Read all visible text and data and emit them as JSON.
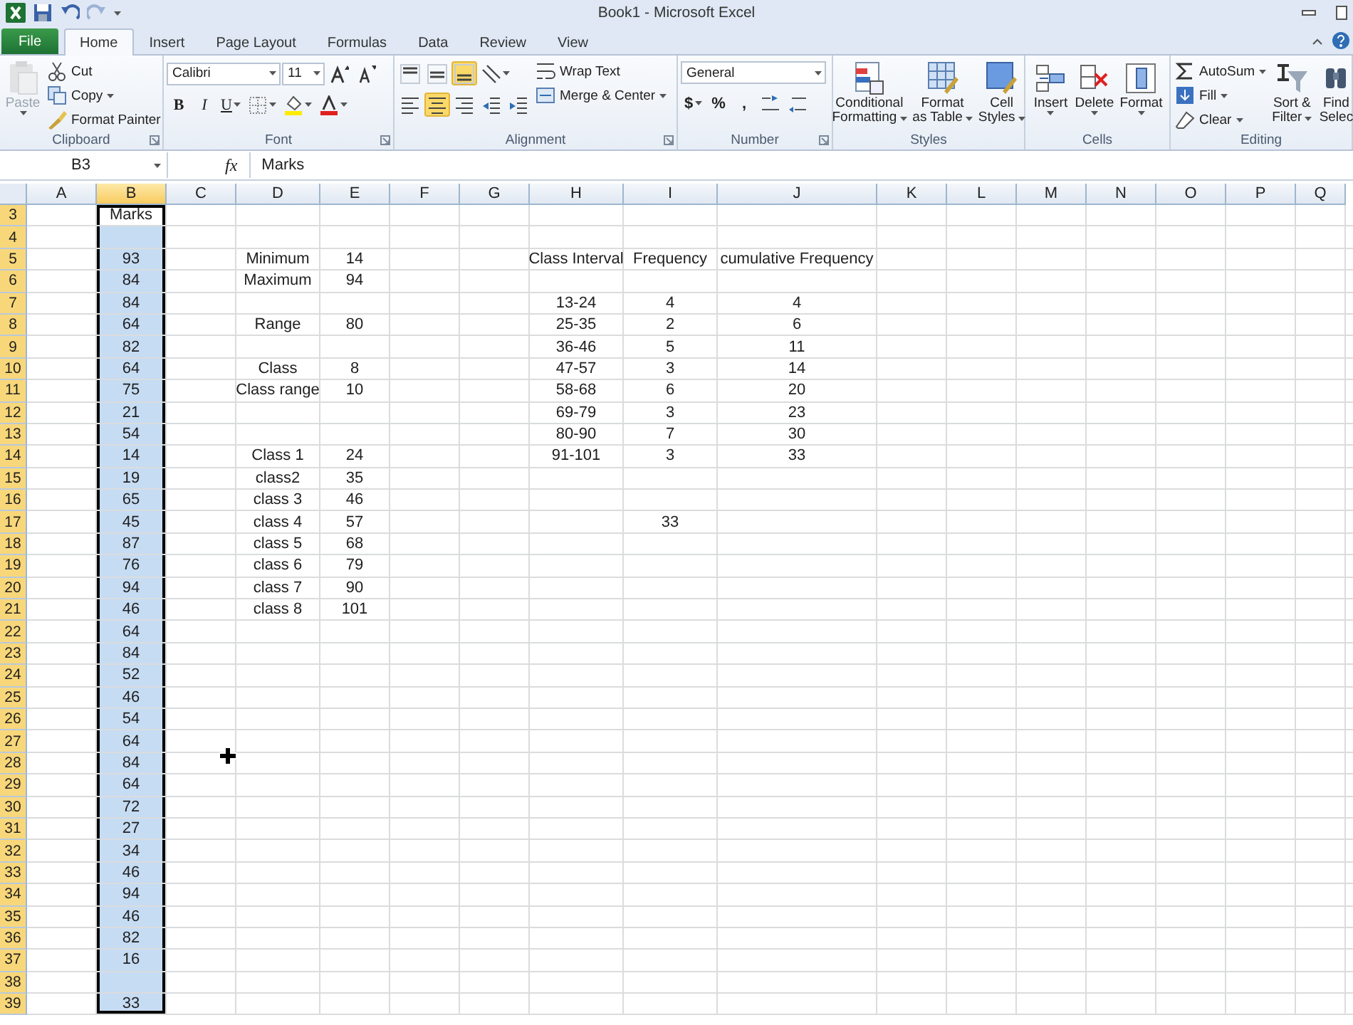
{
  "window": {
    "title": "Book1 - Microsoft Excel"
  },
  "quick_access": [
    {
      "kind": "save",
      "disabled": false
    },
    {
      "kind": "undo",
      "disabled": false
    },
    {
      "kind": "redo",
      "disabled": true
    }
  ],
  "tabs": [
    {
      "label": "File",
      "kind": "file",
      "selected": false
    },
    {
      "label": "Home",
      "kind": "tab",
      "selected": true
    },
    {
      "label": "Insert",
      "kind": "tab",
      "selected": false
    },
    {
      "label": "Page Layout",
      "kind": "tab",
      "selected": false
    },
    {
      "label": "Formulas",
      "kind": "tab",
      "selected": false
    },
    {
      "label": "Data",
      "kind": "tab",
      "selected": false
    },
    {
      "label": "Review",
      "kind": "tab",
      "selected": false
    },
    {
      "label": "View",
      "kind": "tab",
      "selected": false
    }
  ],
  "ribbon": {
    "groups": [
      {
        "label": "Clipboard",
        "launcher": true,
        "blocks": [
          {
            "kind": "big",
            "item": {
              "kind": "paste",
              "lines": [
                "Paste"
              ],
              "dropdown": true,
              "disabled": true
            }
          },
          {
            "kind": "stack",
            "items": [
              {
                "kind": "cut",
                "label": "Cut",
                "dropdown": false
              },
              {
                "kind": "copy",
                "label": "Copy",
                "dropdown": true
              },
              {
                "kind": "painter",
                "label": "Format Painter",
                "dropdown": false
              }
            ]
          }
        ]
      },
      {
        "label": "Font",
        "launcher": true,
        "blocks": [
          {
            "kind": "lines",
            "lines": [
              {
                "items": [
                  {
                    "kind": "fontname",
                    "value": "Calibri"
                  },
                  {
                    "kind": "fontsize",
                    "value": "11"
                  },
                  {
                    "kind": "grow"
                  },
                  {
                    "kind": "shrink"
                  }
                ]
              },
              {
                "items": [
                  {
                    "kind": "bold",
                    "text": "B"
                  },
                  {
                    "kind": "italic",
                    "text": "I"
                  },
                  {
                    "kind": "underline",
                    "text": "U",
                    "dropdown": true
                  },
                  {
                    "kind": "border",
                    "dropdown": true
                  },
                  {
                    "kind": "fill",
                    "dropdown": true
                  },
                  {
                    "kind": "fontcolor",
                    "dropdown": true
                  }
                ]
              }
            ]
          }
        ]
      },
      {
        "label": "Alignment",
        "launcher": true,
        "blocks": [
          {
            "kind": "lines",
            "lines": [
              {
                "items": [
                  {
                    "kind": "aligntop",
                    "selected": false
                  },
                  {
                    "kind": "alignmiddle",
                    "selected": false
                  },
                  {
                    "kind": "alignbottom",
                    "selected": true
                  },
                  {
                    "kind": "orientation",
                    "dropdown": true,
                    "selected": false
                  }
                ]
              },
              {
                "items": [
                  {
                    "kind": "alignleft",
                    "selected": false
                  },
                  {
                    "kind": "aligncenter",
                    "selected": true
                  },
                  {
                    "kind": "alignright",
                    "selected": false
                  },
                  {
                    "kind": "outdent",
                    "selected": false
                  },
                  {
                    "kind": "indent",
                    "selected": false
                  }
                ]
              }
            ]
          },
          {
            "kind": "stack",
            "items": [
              {
                "kind": "wrap",
                "label": "Wrap Text",
                "dropdown": false
              },
              {
                "kind": "merge",
                "label": "Merge & Center",
                "dropdown": true
              }
            ]
          }
        ]
      },
      {
        "label": "Number",
        "launcher": true,
        "blocks": [
          {
            "kind": "lines",
            "lines": [
              {
                "items": [
                  {
                    "kind": "numberformat",
                    "value": "General"
                  }
                ]
              },
              {
                "items": [
                  {
                    "kind": "symbol",
                    "text": "$",
                    "dropdown": true
                  },
                  {
                    "kind": "symbol",
                    "text": "%"
                  },
                  {
                    "kind": "symbol",
                    "text": ","
                  },
                  {
                    "kind": "moredec"
                  },
                  {
                    "kind": "lessdec"
                  }
                ]
              }
            ]
          }
        ]
      },
      {
        "label": "Styles",
        "launcher": false,
        "blocks": [
          {
            "kind": "big",
            "item": {
              "kind": "conditional",
              "lines": [
                "Conditional",
                "Formatting"
              ],
              "dropdown": true
            }
          },
          {
            "kind": "big",
            "item": {
              "kind": "table",
              "lines": [
                "Format",
                "as Table"
              ],
              "dropdown": true
            }
          },
          {
            "kind": "big",
            "item": {
              "kind": "cellstyles",
              "lines": [
                "Cell",
                "Styles"
              ],
              "dropdown": true
            }
          }
        ]
      },
      {
        "label": "Cells",
        "launcher": false,
        "blocks": [
          {
            "kind": "big",
            "item": {
              "kind": "insert",
              "lines": [
                "Insert"
              ],
              "dropdown": true
            }
          },
          {
            "kind": "big",
            "item": {
              "kind": "delete",
              "lines": [
                "Delete"
              ],
              "dropdown": true
            }
          },
          {
            "kind": "big",
            "item": {
              "kind": "format",
              "lines": [
                "Format"
              ],
              "dropdown": true
            }
          }
        ]
      },
      {
        "label": "Editing",
        "launcher": false,
        "blocks": [
          {
            "kind": "stack",
            "items": [
              {
                "kind": "autosum",
                "label": "AutoSum",
                "dropdown": true
              },
              {
                "kind": "filldown",
                "label": "Fill",
                "dropdown": true
              },
              {
                "kind": "clear",
                "label": "Clear",
                "dropdown": true
              }
            ]
          },
          {
            "kind": "big",
            "item": {
              "kind": "sort",
              "lines": [
                "Sort &",
                "Filter"
              ],
              "dropdown": true
            }
          },
          {
            "kind": "big",
            "item": {
              "kind": "find",
              "lines": [
                "Find",
                "Selec"
              ],
              "dropdown": false
            }
          }
        ]
      }
    ]
  },
  "formula_bar": {
    "name_box": "B3",
    "function_label": "fx",
    "formula": "Marks"
  },
  "sheet": {
    "columns": [
      {
        "label": "A",
        "selected": false
      },
      {
        "label": "B",
        "selected": true
      },
      {
        "label": "C",
        "selected": false
      },
      {
        "label": "D",
        "selected": false
      },
      {
        "label": "E",
        "selected": false
      },
      {
        "label": "F",
        "selected": false
      },
      {
        "label": "G",
        "selected": false
      },
      {
        "label": "H",
        "selected": false
      },
      {
        "label": "I",
        "selected": false
      },
      {
        "label": "J",
        "selected": false
      },
      {
        "label": "K",
        "selected": false
      },
      {
        "label": "L",
        "selected": false
      },
      {
        "label": "M",
        "selected": false
      },
      {
        "label": "N",
        "selected": false
      },
      {
        "label": "O",
        "selected": false
      },
      {
        "label": "P",
        "selected": false
      },
      {
        "label": "Q",
        "selected": false
      }
    ],
    "rows": [
      {
        "label": "3",
        "selected": true,
        "active": true,
        "cells": [
          null,
          "Marks"
        ]
      },
      {
        "label": "4",
        "selected": true,
        "active": false,
        "cells": []
      },
      {
        "label": "5",
        "selected": true,
        "active": false,
        "cells": [
          null,
          "93",
          null,
          "Minimum",
          "14",
          null,
          null,
          "Class Interval",
          "Frequency",
          "cumulative Frequency"
        ]
      },
      {
        "label": "6",
        "selected": true,
        "active": false,
        "cells": [
          null,
          "84",
          null,
          "Maximum",
          "94"
        ]
      },
      {
        "label": "7",
        "selected": true,
        "active": false,
        "cells": [
          null,
          "84",
          null,
          null,
          null,
          null,
          null,
          "13-24",
          "4",
          "4"
        ]
      },
      {
        "label": "8",
        "selected": true,
        "active": false,
        "cells": [
          null,
          "64",
          null,
          "Range",
          "80",
          null,
          null,
          "25-35",
          "2",
          "6"
        ]
      },
      {
        "label": "9",
        "selected": true,
        "active": false,
        "cells": [
          null,
          "82",
          null,
          null,
          null,
          null,
          null,
          "36-46",
          "5",
          "11"
        ]
      },
      {
        "label": "10",
        "selected": true,
        "active": false,
        "cells": [
          null,
          "64",
          null,
          "Class",
          "8",
          null,
          null,
          "47-57",
          "3",
          "14"
        ]
      },
      {
        "label": "11",
        "selected": true,
        "active": false,
        "cells": [
          null,
          "75",
          null,
          "Class range",
          "10",
          null,
          null,
          "58-68",
          "6",
          "20"
        ]
      },
      {
        "label": "12",
        "selected": true,
        "active": false,
        "cells": [
          null,
          "21",
          null,
          null,
          null,
          null,
          null,
          "69-79",
          "3",
          "23"
        ]
      },
      {
        "label": "13",
        "selected": true,
        "active": false,
        "cells": [
          null,
          "54",
          null,
          null,
          null,
          null,
          null,
          "80-90",
          "7",
          "30"
        ]
      },
      {
        "label": "14",
        "selected": true,
        "active": false,
        "cells": [
          null,
          "14",
          null,
          "Class 1",
          "24",
          null,
          null,
          "91-101",
          "3",
          "33"
        ]
      },
      {
        "label": "15",
        "selected": true,
        "active": false,
        "cells": [
          null,
          "19",
          null,
          "class2",
          "35"
        ]
      },
      {
        "label": "16",
        "selected": true,
        "active": false,
        "cells": [
          null,
          "65",
          null,
          "class 3",
          "46"
        ]
      },
      {
        "label": "17",
        "selected": true,
        "active": false,
        "cells": [
          null,
          "45",
          null,
          "class 4",
          "57",
          null,
          null,
          null,
          "33"
        ]
      },
      {
        "label": "18",
        "selected": true,
        "active": false,
        "cells": [
          null,
          "87",
          null,
          "class 5",
          "68"
        ]
      },
      {
        "label": "19",
        "selected": true,
        "active": false,
        "cells": [
          null,
          "76",
          null,
          "class 6",
          "79"
        ]
      },
      {
        "label": "20",
        "selected": true,
        "active": false,
        "cells": [
          null,
          "94",
          null,
          "class 7",
          "90"
        ]
      },
      {
        "label": "21",
        "selected": true,
        "active": false,
        "cells": [
          null,
          "46",
          null,
          "class 8",
          "101"
        ]
      },
      {
        "label": "22",
        "selected": true,
        "active": false,
        "cells": [
          null,
          "64"
        ]
      },
      {
        "label": "23",
        "selected": true,
        "active": false,
        "cells": [
          null,
          "84"
        ]
      },
      {
        "label": "24",
        "selected": true,
        "active": false,
        "cells": [
          null,
          "52"
        ]
      },
      {
        "label": "25",
        "selected": true,
        "active": false,
        "cells": [
          null,
          "46"
        ]
      },
      {
        "label": "26",
        "selected": true,
        "active": false,
        "cells": [
          null,
          "54"
        ]
      },
      {
        "label": "27",
        "selected": true,
        "active": false,
        "cells": [
          null,
          "64"
        ]
      },
      {
        "label": "28",
        "selected": true,
        "active": false,
        "cells": [
          null,
          "84"
        ]
      },
      {
        "label": "29",
        "selected": true,
        "active": false,
        "cells": [
          null,
          "64"
        ]
      },
      {
        "label": "30",
        "selected": true,
        "active": false,
        "cells": [
          null,
          "72"
        ]
      },
      {
        "label": "31",
        "selected": true,
        "active": false,
        "cells": [
          null,
          "27"
        ]
      },
      {
        "label": "32",
        "selected": true,
        "active": false,
        "cells": [
          null,
          "34"
        ]
      },
      {
        "label": "33",
        "selected": true,
        "active": false,
        "cells": [
          null,
          "46"
        ]
      },
      {
        "label": "34",
        "selected": true,
        "active": false,
        "cells": [
          null,
          "94"
        ]
      },
      {
        "label": "35",
        "selected": true,
        "active": false,
        "cells": [
          null,
          "46"
        ]
      },
      {
        "label": "36",
        "selected": true,
        "active": false,
        "cells": [
          null,
          "82"
        ]
      },
      {
        "label": "37",
        "selected": true,
        "active": false,
        "cells": [
          null,
          "16"
        ]
      },
      {
        "label": "38",
        "selected": true,
        "active": false,
        "cells": []
      },
      {
        "label": "39",
        "selected": true,
        "active": false,
        "cells": [
          null,
          "33"
        ]
      }
    ]
  }
}
